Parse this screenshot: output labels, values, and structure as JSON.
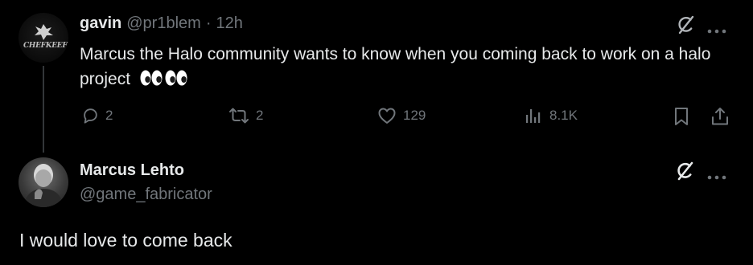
{
  "tweet": {
    "author_name": "gavin",
    "handle": "@pr1blem",
    "separator": "·",
    "time": "12h",
    "text": "Marcus the Halo community wants to know when you coming back to work on a halo project",
    "emoji": [
      "eyes",
      "eyes"
    ],
    "avatar_text": "CHEFKEEF",
    "actions": {
      "replies": "2",
      "reposts": "2",
      "likes": "129",
      "views": "8.1K"
    }
  },
  "reply": {
    "author_name": "Marcus Lehto",
    "handle": "@game_fabricator",
    "text": "I would love to come back"
  },
  "icons": {
    "grok": "grok-icon",
    "more": "more-icon",
    "reply": "reply-icon",
    "repost": "repost-icon",
    "like": "heart-icon",
    "views": "views-icon",
    "bookmark": "bookmark-icon",
    "share": "share-icon"
  },
  "colors": {
    "background": "#000000",
    "primary_text": "#e7e9ea",
    "secondary_text": "#71767b",
    "thread_line": "#333639"
  }
}
